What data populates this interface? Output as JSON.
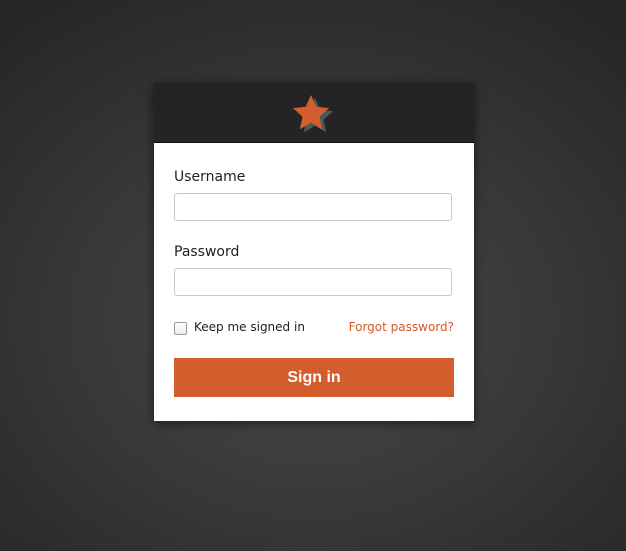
{
  "login": {
    "username_label": "Username",
    "username_value": "",
    "password_label": "Password",
    "password_value": "",
    "remember_label": "Keep me signed in",
    "remember_checked": false,
    "forgot_label": "Forgot password?",
    "submit_label": "Sign in"
  },
  "icons": {
    "logo": "star-icon"
  },
  "colors": {
    "accent": "#d35d2c",
    "header_bg": "#242424",
    "link": "#d25a28",
    "star_shadow": "#4a5a5a"
  }
}
